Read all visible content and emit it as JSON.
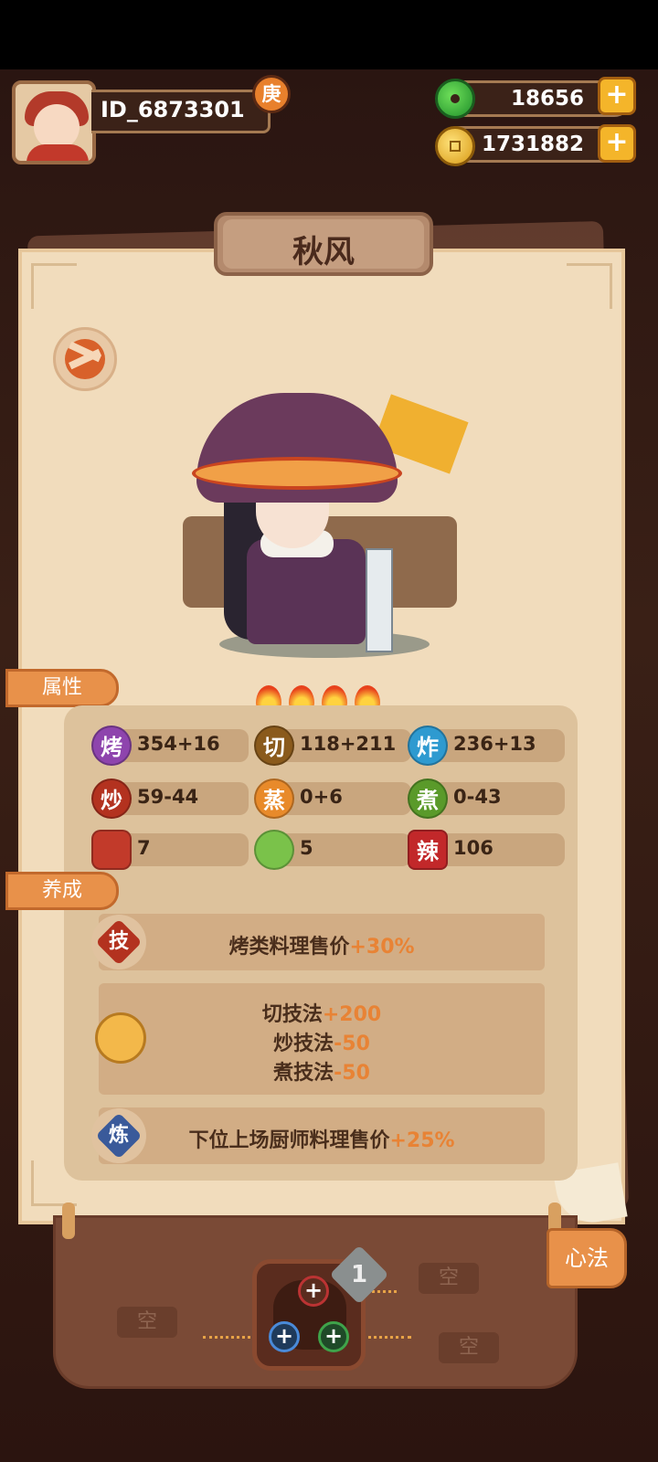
{
  "player": {
    "id": "ID_6873301",
    "rank_badge": "庚"
  },
  "currencies": {
    "jade": "18656",
    "coins": "1731882",
    "add_label": "+"
  },
  "chef": {
    "name": "秋风",
    "stars": 4,
    "sections": {
      "attributes": "属性",
      "cultivation": "养成"
    },
    "stats": [
      {
        "icon": "烤",
        "value": "354+16",
        "color": "#8e44ad"
      },
      {
        "icon": "切",
        "value": "118+211",
        "color": "#8a5a1c"
      },
      {
        "icon": "炸",
        "value": "236+13",
        "color": "#2e9ad0"
      },
      {
        "icon": "炒",
        "value": "59-44",
        "color": "#b3321f"
      },
      {
        "icon": "蒸",
        "value": "0+6",
        "color": "#e88a2a"
      },
      {
        "icon": "煮",
        "value": "0-43",
        "color": "#5a9a2a"
      },
      {
        "icon": "",
        "value": "7",
        "color": "#c23a2a"
      },
      {
        "icon": "",
        "value": "5",
        "color": "#7ac24a"
      },
      {
        "icon": "辣",
        "value": "106",
        "color": "#c2282a"
      }
    ],
    "skills": {
      "technique": {
        "badge": "技",
        "text": "烤类料理售价",
        "bonus": "+30%"
      },
      "pet": {
        "lines": [
          {
            "text": "切技法",
            "bonus": "+200"
          },
          {
            "text": "炒技法",
            "bonus": "-50"
          },
          {
            "text": "煮技法",
            "bonus": "-50"
          }
        ]
      },
      "refine": {
        "badge": "炼",
        "text": "下位上场厨师料理售价",
        "bonus": "+25%"
      }
    }
  },
  "heart_method": {
    "level": "1",
    "empty_label": "空",
    "button_label": "心法"
  }
}
